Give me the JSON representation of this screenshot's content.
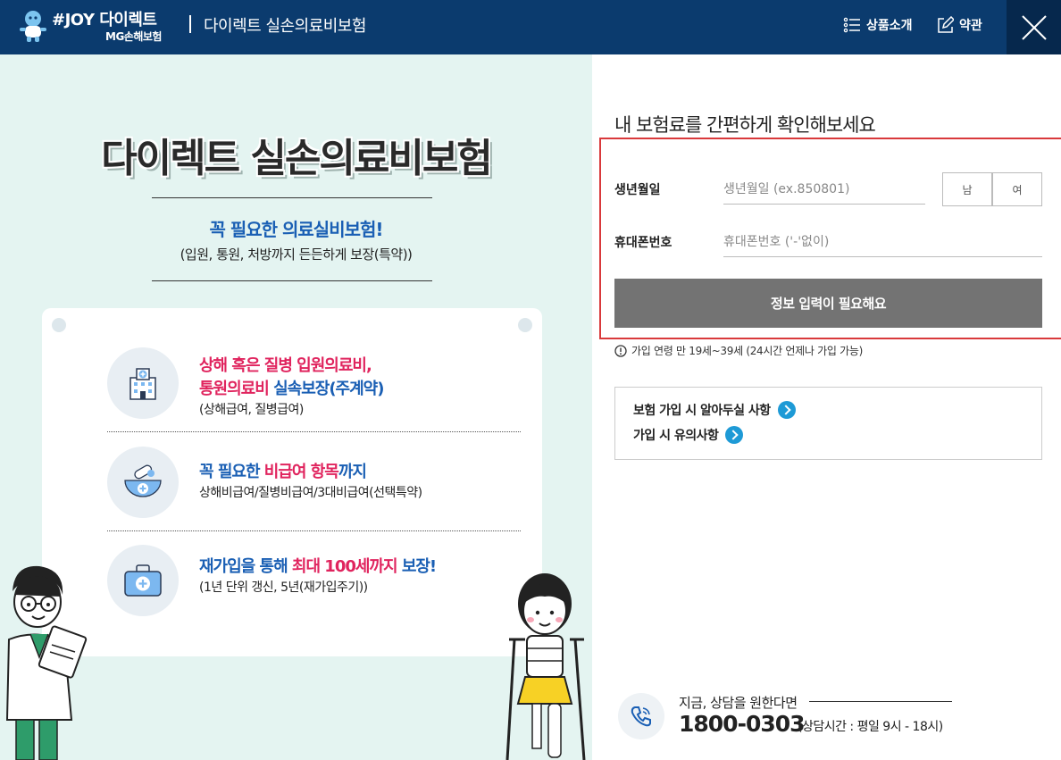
{
  "header": {
    "brand_main": "#JOY 다이렉트",
    "brand_sub": "MG손해보험",
    "title": "다이렉트 실손의료비보험",
    "nav_products": "상품소개",
    "nav_terms": "약관",
    "icons": {
      "mascot": "mascot-icon",
      "list": "list-icon",
      "edit": "edit-icon",
      "close": "close-icon"
    }
  },
  "hero": {
    "title": "다이렉트 실손의료비보험",
    "subtitle": "꼭 필요한 의료실비보험!",
    "description": "(입원, 통원, 처방까지 든든하게 보장(특약))"
  },
  "features": [
    {
      "icon": "hospital-icon",
      "line1": "상해 혹은 질병 입원의료비,",
      "line2a": "통원의료비",
      "line2b": " 실속보장(주계약)",
      "small": "(상해급여, 질병급여)"
    },
    {
      "icon": "medicine-bowl-icon",
      "line1a": "꼭 필요한 ",
      "line1b": "비급여 항목",
      "line1c": "까지",
      "small": "상해비급여/질병비급여/3대비급여(선택특약)"
    },
    {
      "icon": "first-aid-kit-icon",
      "line1a": "재가입을 통해 ",
      "line1b": "최대 100세까지",
      "line1c": " 보장!",
      "small": "(1년 단위 갱신, 5년(재가입주기))"
    }
  ],
  "form": {
    "heading": "내 보험료를 간편하게 확인해보세요",
    "birth_label": "생년월일",
    "birth_placeholder": "생년월일 (ex.850801)",
    "gender_male": "남",
    "gender_female": "여",
    "phone_label": "휴대폰번호",
    "phone_placeholder": "휴대폰번호 ('-'없이)",
    "submit_label": "정보 입력이 필요해요",
    "age_note": "가입 연령 만 19세~39세 (24시간 언제나 가입 가능)"
  },
  "info_links": [
    {
      "label": "보험 가입 시 알아두실 사항"
    },
    {
      "label": "가입 시 유의사항"
    }
  ],
  "consult": {
    "text": "지금, 상담을 원한다면",
    "phone": "1800-0303",
    "hours": "(상담시간 : 평일 9시 - 18시)"
  },
  "colors": {
    "header_bg": "#0b3b6e",
    "left_bg": "#e4f4f1",
    "accent_blue": "#1a5fb4",
    "accent_pink": "#e0245e",
    "highlight_border": "#d9393b",
    "submit_bg": "#737373",
    "arrow_blue": "#1e9ad6"
  }
}
